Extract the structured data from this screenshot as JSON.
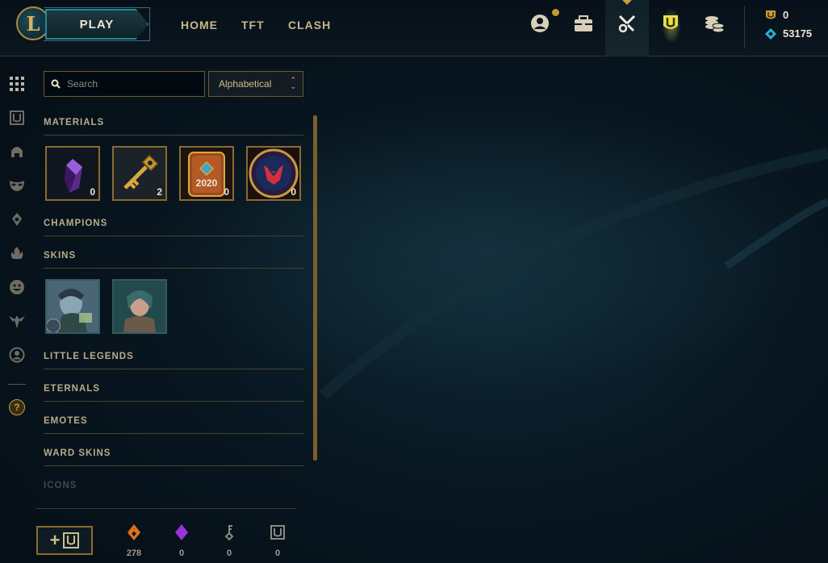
{
  "nav": {
    "play": "PLAY",
    "home": "HOME",
    "tft": "TFT",
    "clash": "CLASH"
  },
  "top_icons": [
    "profile-icon",
    "collection-icon",
    "loot-icon",
    "rank-token-icon",
    "store-icon"
  ],
  "currency": {
    "orange_essence": "0",
    "blue_essence": "53175"
  },
  "sidebar": {
    "items": [
      "grid-icon",
      "chest-icon",
      "helmet-icon",
      "mask-icon",
      "ward-icon",
      "fire-icon",
      "emote-icon",
      "eternals-icon",
      "profile-circle-icon",
      "help-icon"
    ],
    "help_label": "?"
  },
  "search": {
    "placeholder": "Search"
  },
  "sort": {
    "selected": "Alphabetical"
  },
  "categories": {
    "materials": "MATERIALS",
    "champions": "CHAMPIONS",
    "skins": "SKINS",
    "little_legends": "LITTLE LEGENDS",
    "eternals": "ETERNALS",
    "emotes": "EMOTES",
    "ward_skins": "WARD SKINS",
    "icons": "ICONS"
  },
  "materials": [
    {
      "name": "purple-gem",
      "count": "0"
    },
    {
      "name": "key",
      "count": "2"
    },
    {
      "name": "2020-capsule",
      "count": "0",
      "label": "2020"
    },
    {
      "name": "worlds-orb",
      "count": "0"
    }
  ],
  "bottom": {
    "orange_essence": "278",
    "mythic_essence": "0",
    "key_fragments": "0",
    "chests": "0"
  },
  "colors": {
    "gold": "#c89b3c",
    "teal": "#1e8a9a",
    "background": "#081620"
  }
}
